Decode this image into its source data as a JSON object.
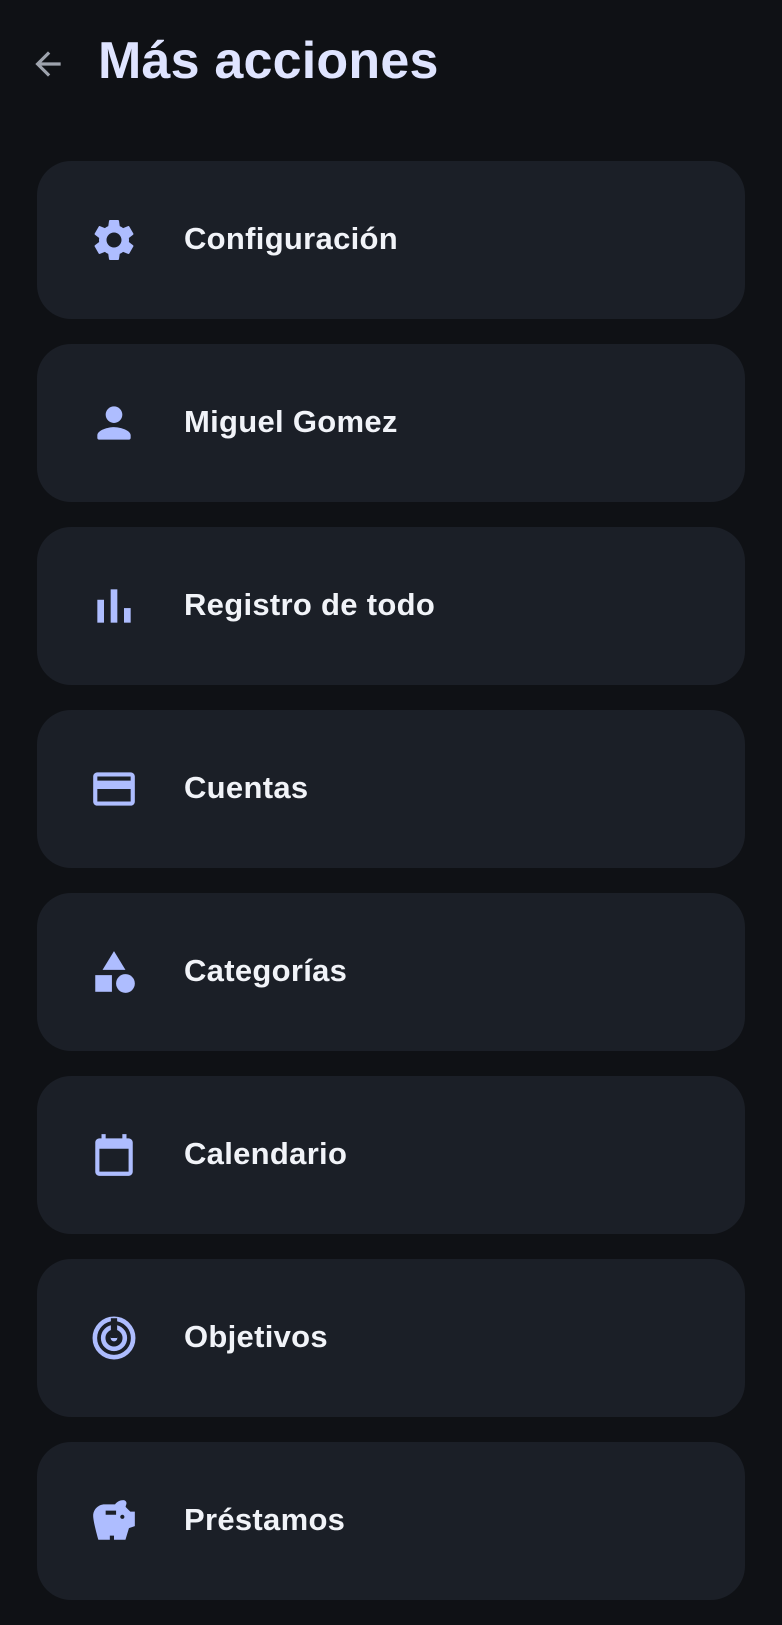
{
  "header": {
    "title": "Más acciones",
    "back_icon": "arrow-back-icon"
  },
  "colors": {
    "background": "#0f1115",
    "card": "#1b1f27",
    "icon_accent": "#aebdff",
    "title": "#dfe4ff",
    "label": "#f1f3f8"
  },
  "menu": {
    "items": [
      {
        "label": "Configuración",
        "icon": "gear-icon"
      },
      {
        "label": "Miguel Gomez",
        "icon": "person-icon"
      },
      {
        "label": "Registro de todo",
        "icon": "bar-chart-icon"
      },
      {
        "label": "Cuentas",
        "icon": "credit-card-icon"
      },
      {
        "label": "Categorías",
        "icon": "shapes-icon"
      },
      {
        "label": "Calendario",
        "icon": "calendar-icon"
      },
      {
        "label": "Objetivos",
        "icon": "target-icon"
      },
      {
        "label": "Préstamos",
        "icon": "piggy-bank-icon"
      }
    ]
  }
}
